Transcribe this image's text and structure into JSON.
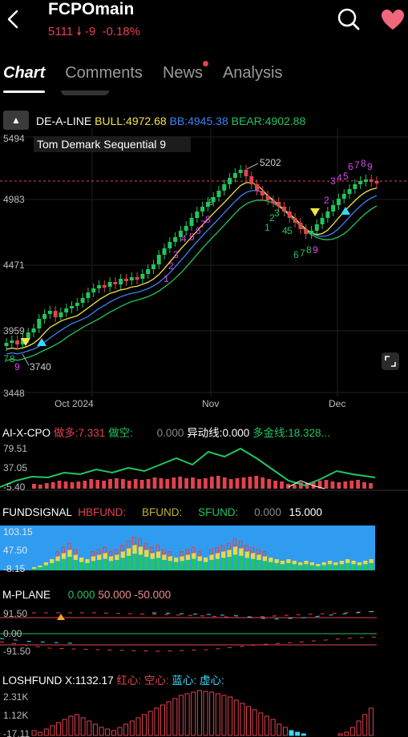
{
  "header": {
    "title": "FCPOmain",
    "price": "5111",
    "change": "-9",
    "change_pct": "-0.18%",
    "back_icon": "chevron-left-icon",
    "search_icon": "search-icon",
    "favorite_icon": "heart-icon"
  },
  "tabs": [
    {
      "label": "Chart",
      "active": true
    },
    {
      "label": "Comments",
      "active": false
    },
    {
      "label": "News",
      "active": false,
      "badge": true
    },
    {
      "label": "Analysis",
      "active": false
    }
  ],
  "main_indicator": {
    "name": "DE-A-LINE",
    "bull": "BULL:4972.68",
    "bb": "BB:4945.38",
    "bear": "BEAR:4902.88",
    "study_label": "Tom Demark Sequential 9"
  },
  "main_axis": {
    "y_labels": [
      "5494",
      "4983",
      "4471",
      "3959",
      "3448"
    ],
    "x_labels": [
      "Oct 2024",
      "Nov",
      "Dec"
    ],
    "high_label": "5202",
    "low_label": "3740"
  },
  "td_counts": [
    "1",
    "2",
    "3",
    "4",
    "5",
    "6",
    "7",
    "8",
    "9"
  ],
  "ai_x_cpo": {
    "name": "AI-X-CPO",
    "long_label": "做多:7.331",
    "short_label": "做空:",
    "short_value": "0.000",
    "abnormal_label": "异动线:0.000",
    "gold_label": "多金线:18.328...",
    "y_labels": [
      "79.51",
      "37.05",
      "-5.40"
    ]
  },
  "fundsignal": {
    "name": "FUNDSIGNAL",
    "hb": "HBFUND:",
    "b": "BFUND:",
    "s": "SFUND:",
    "s_value": "0.000",
    "value": "15.000",
    "y_labels": [
      "103.15",
      "47.50",
      "-8.15"
    ]
  },
  "m_plane": {
    "name": "M-PLANE",
    "v1": "0.000",
    "v2": "50.000",
    "v3": "-50.000",
    "y_labels": [
      "91.50",
      "0.00",
      "-91.50"
    ]
  },
  "loshfund": {
    "name": "LOSHFUND",
    "x_label": "X:1132.17",
    "red_label": "红心:",
    "hollow_label": "空心:",
    "blue_label": "蓝心:",
    "virtual_label": "虚心:",
    "y_labels": [
      "2.31K",
      "1.12K",
      "-17.11"
    ]
  },
  "colors": {
    "up": "#e0434e",
    "down": "#22c55e",
    "bull": "#f5e642",
    "bb": "#3b82f6",
    "bear": "#22c55e",
    "td": "#d946ef",
    "cyan": "#38d9f5",
    "fund_bg": "#2f9cf0"
  }
}
